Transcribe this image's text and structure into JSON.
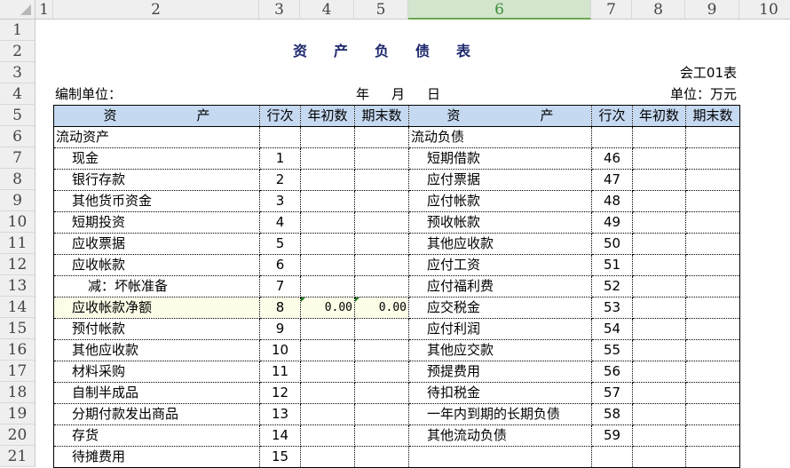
{
  "columns": [
    "1",
    "2",
    "3",
    "4",
    "5",
    "6",
    "7",
    "8",
    "9",
    "10"
  ],
  "selected_column": "6",
  "rows": [
    "1",
    "2",
    "3",
    "4",
    "5",
    "6",
    "7",
    "8",
    "9",
    "10",
    "11",
    "12",
    "13",
    "14",
    "15",
    "16",
    "17",
    "18",
    "19",
    "20",
    "21"
  ],
  "title": "资产负债表",
  "form_code": "会工01表",
  "unit": "单位：万元",
  "preparer_label": "编制单位：",
  "date": {
    "year": "年",
    "month": "月",
    "day": "日"
  },
  "header": {
    "asset": "资　　　　　　产",
    "line": "行次",
    "begin": "年初数",
    "end": "期末数",
    "liab": "资　　　　　　产"
  },
  "table_rows": [
    {
      "left": "流动资产",
      "lind": 0,
      "ln": "",
      "lb": "",
      "le": "",
      "right": "流动负债",
      "rind": 0,
      "rn": ""
    },
    {
      "left": "现金",
      "lind": 1,
      "ln": "1",
      "lb": "",
      "le": "",
      "right": "短期借款",
      "rind": 1,
      "rn": "46"
    },
    {
      "left": "银行存款",
      "lind": 1,
      "ln": "2",
      "lb": "",
      "le": "",
      "right": "应付票据",
      "rind": 1,
      "rn": "47"
    },
    {
      "left": "其他货币资金",
      "lind": 1,
      "ln": "3",
      "lb": "",
      "le": "",
      "right": "应付帐款",
      "rind": 1,
      "rn": "48"
    },
    {
      "left": "短期投资",
      "lind": 1,
      "ln": "4",
      "lb": "",
      "le": "",
      "right": "预收帐款",
      "rind": 1,
      "rn": "49"
    },
    {
      "left": "应收票据",
      "lind": 1,
      "ln": "5",
      "lb": "",
      "le": "",
      "right": "其他应收款",
      "rind": 1,
      "rn": "50"
    },
    {
      "left": "应收帐款",
      "lind": 1,
      "ln": "6",
      "lb": "",
      "le": "",
      "right": "应付工资",
      "rind": 1,
      "rn": "51"
    },
    {
      "left": "减：坏帐准备",
      "lind": 2,
      "ln": "7",
      "lb": "",
      "le": "",
      "right": "应付福利费",
      "rind": 1,
      "rn": "52"
    },
    {
      "left": "应收帐款净额",
      "lind": 1,
      "ln": "8",
      "lb": "0.00",
      "le": "0.00",
      "right": "应交税金",
      "rind": 1,
      "rn": "53",
      "hl": true
    },
    {
      "left": "预付帐款",
      "lind": 1,
      "ln": "9",
      "lb": "",
      "le": "",
      "right": "应付利润",
      "rind": 1,
      "rn": "54"
    },
    {
      "left": "其他应收款",
      "lind": 1,
      "ln": "10",
      "lb": "",
      "le": "",
      "right": "其他应交款",
      "rind": 1,
      "rn": "55"
    },
    {
      "left": "材料采购",
      "lind": 1,
      "ln": "11",
      "lb": "",
      "le": "",
      "right": "预提费用",
      "rind": 1,
      "rn": "56"
    },
    {
      "left": "自制半成品",
      "lind": 1,
      "ln": "12",
      "lb": "",
      "le": "",
      "right": "待扣税金",
      "rind": 1,
      "rn": "57"
    },
    {
      "left": "分期付款发出商品",
      "lind": 1,
      "ln": "13",
      "lb": "",
      "le": "",
      "right": "一年内到期的长期负债",
      "rind": 1,
      "rn": "58"
    },
    {
      "left": "存货",
      "lind": 1,
      "ln": "14",
      "lb": "",
      "le": "",
      "right": "其他流动负债",
      "rind": 1,
      "rn": "59"
    },
    {
      "left": "待摊费用",
      "lind": 1,
      "ln": "15",
      "lb": "",
      "le": "",
      "right": "",
      "rind": 1,
      "rn": ""
    }
  ]
}
